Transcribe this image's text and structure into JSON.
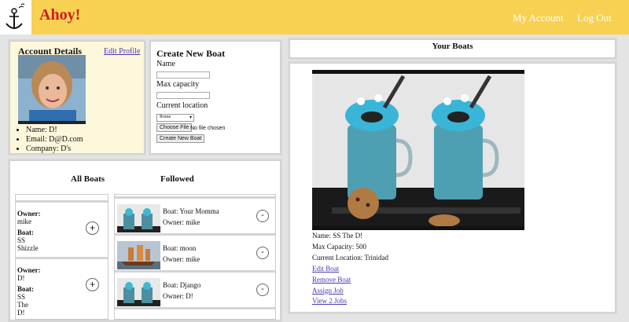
{
  "brand": "Ahoy!",
  "nav": {
    "account": "My Account",
    "logout": "Log Out"
  },
  "account": {
    "title": "Account Details",
    "edit": "Edit Profile",
    "name": "Name: D!",
    "email": "Email: D@D.com",
    "company": "Company: D's"
  },
  "create": {
    "title": "Create New Boat",
    "name_label": "Name",
    "capacity_label": "Max capacity",
    "location_label": "Current location",
    "location_value": "Rome",
    "choose_file": "Choose File",
    "no_file": "No file chosen",
    "submit": "Create New Boat"
  },
  "lists": {
    "all_title": "All Boats",
    "followed_title": "Followed",
    "all_boats": [
      {
        "owner_label": "Owner:",
        "owner": "mike",
        "boat_label": "Boat:",
        "boat_lines": [
          "SS",
          "Shizzle"
        ]
      },
      {
        "owner_label": "Owner:",
        "owner": "D!",
        "boat_label": "Boat:",
        "boat_lines": [
          "SS",
          "The",
          "D!"
        ]
      }
    ],
    "followed": [
      {
        "boat": "Boat: Your Momma",
        "owner": "Owner: mike"
      },
      {
        "boat": "Boat: moon",
        "owner": "Owner: mike"
      },
      {
        "boat": "Boat: Django",
        "owner": "Owner: D!"
      }
    ],
    "plus_symbol": "+",
    "minus_symbol": "-"
  },
  "your_boats": {
    "title": "Your Boats",
    "name": "Name: SS The D!",
    "capacity": "Max Capacity: 500",
    "location": "Current Location: Trinidad",
    "edit": "Edit Boat",
    "remove": "Remove Boat",
    "assign": "Assign Job",
    "jobs": "View 2 Jobs"
  },
  "colors": {
    "header": "#f8d152",
    "brand": "#d01c1c",
    "link": "#4838b5",
    "account_bg": "#fdf7dc"
  }
}
